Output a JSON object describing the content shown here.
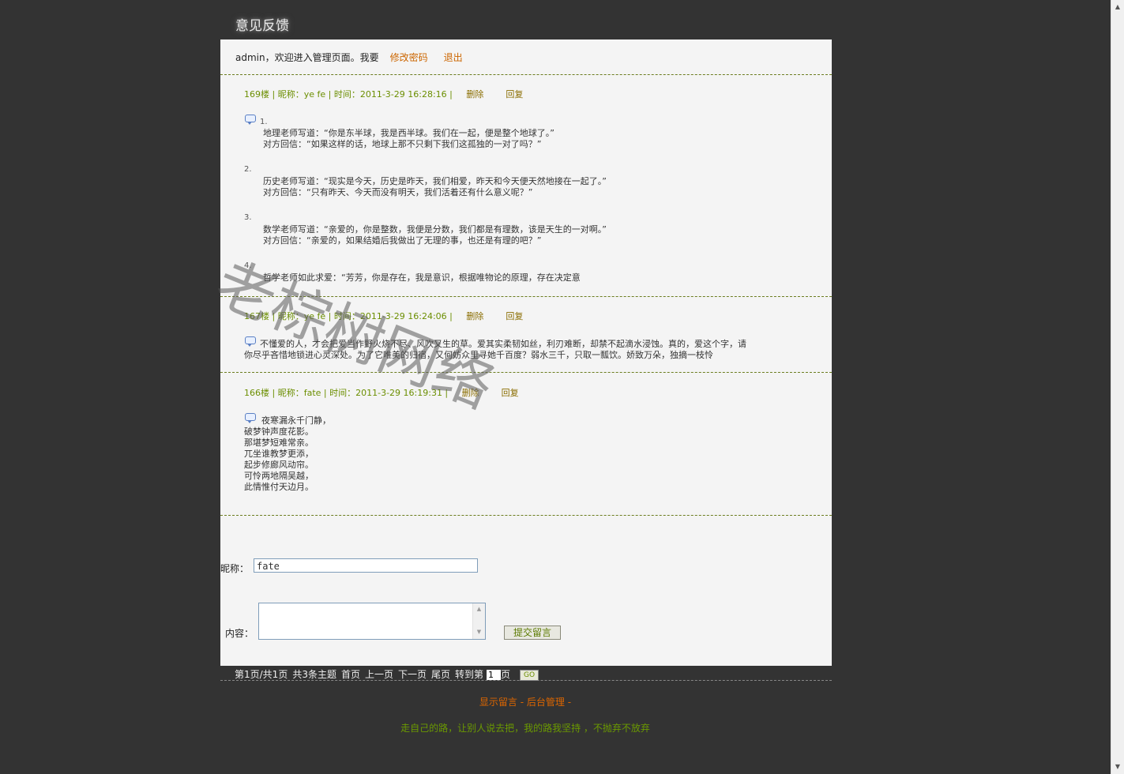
{
  "site": {
    "title": "意见反馈"
  },
  "topbar": {
    "welcome": "admin，欢迎进入管理页面。我要",
    "change_password": "修改密码",
    "logout": "退出"
  },
  "posts": [
    {
      "floor": "169楼",
      "nick_label": "昵称：",
      "nick": "ye fe",
      "time_label": "时间：",
      "time": "2011-3-29 16:28:16",
      "delete": "删除",
      "reply": "回复",
      "items": [
        {
          "n": "1.",
          "lines": [
            "地理老师写道：“你是东半球，我是西半球。我们在一起，便是整个地球了。”",
            "对方回信：“如果这样的话，地球上那不只剩下我们这孤独的一对了吗？”"
          ]
        },
        {
          "n": "2.",
          "lines": [
            "历史老师写道：“现实是今天，历史是昨天，我们相爱，昨天和今天便天然地接在一起了。”",
            "对方回信：“只有昨天、今天而没有明天，我们活着还有什么意义呢？”"
          ]
        },
        {
          "n": "3.",
          "lines": [
            "数学老师写道：“亲爱的，你是整数，我便是分数，我们都是有理数，该是天生的一对啊。”",
            "对方回信：“亲爱的，如果结婚后我做出了无理的事，也还是有理的吧？”"
          ]
        },
        {
          "n": "4.",
          "lines": [
            "哲学老师如此求爱：“芳芳，你是存在，我是意识，根据唯物论的原理，存在决定意"
          ]
        }
      ]
    },
    {
      "floor": "167楼",
      "nick_label": "昵称：",
      "nick": "ye fe",
      "time_label": "时间：",
      "time": "2011-3-29 16:24:06",
      "delete": "删除",
      "reply": "回复",
      "lines": [
        "不懂爱的人，才会把爱当作野火烧不尽、风吹又生的草。爱其实柔韧如丝，利刃难断，却禁不起滴水浸蚀。真的，爱这个字，请",
        "你尽乎吝惜地锁进心灵深处。为了它唯美的归宿，又何妨众里寻她千百度？弱水三千，只取一瓢饮。娇致万朵，独摘一枝怜"
      ]
    },
    {
      "floor": "166楼",
      "nick_label": "昵称：",
      "nick": "fate",
      "time_label": "时间：",
      "time": "2011-3-29 16:19:31",
      "delete": "删除",
      "reply": "回复",
      "lines": [
        "夜寒漏永千门静，",
        "破梦钟声度花影。",
        "那堪梦短难常亲。",
        "兀坐谁教梦更添，",
        "起步修廊风动帘。",
        "可怜两地隔吴越，",
        "此情惟付天边月。"
      ]
    }
  ],
  "form": {
    "nick_label": "昵称：",
    "nick_value": "fate",
    "content_label": "内容：",
    "submit": "提交留言"
  },
  "pager": {
    "page_info": "第1页/共1页",
    "total": "共3条主题",
    "first": "首页",
    "prev": "上一页",
    "next": "下一页",
    "last": "尾页",
    "goto": "转到第",
    "page_value": "1",
    "page_suffix": "页",
    "go": "GO"
  },
  "footer": {
    "show_messages": "显示留言",
    "separator": " - ",
    "admin": "后台管理",
    "trailing": " -",
    "motto": "走自己的路，让别人说去把，我的路我坚持 ，不抛弃不放弃"
  },
  "watermark": {
    "text": "老棕树网络"
  },
  "colors": {
    "background": "#333333",
    "panel": "#f4f4f4",
    "accent_green": "#6b8e00",
    "accent_orange": "#dd6600"
  }
}
